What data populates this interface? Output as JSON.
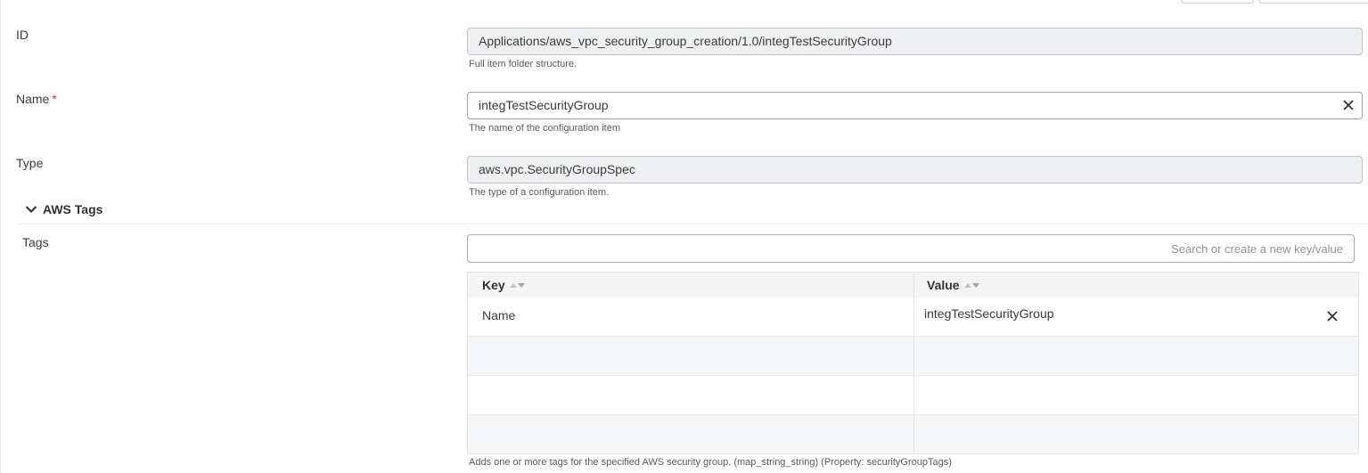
{
  "fields": {
    "id": {
      "label": "ID",
      "value": "Applications/aws_vpc_security_group_creation/1.0/integTestSecurityGroup",
      "help": "Full item folder structure."
    },
    "name": {
      "label": "Name",
      "required_mark": "*",
      "value": "integTestSecurityGroup",
      "help": "The name of the configuration item",
      "clear_icon": "close-icon"
    },
    "type": {
      "label": "Type",
      "value": "aws.vpc.SecurityGroupSpec",
      "help": "The type of a configuration item."
    }
  },
  "section": {
    "title": "AWS Tags",
    "icon": "chevron-down-icon"
  },
  "tags": {
    "label": "Tags",
    "search_placeholder": "Search or create a new key/value",
    "columns": {
      "key": "Key",
      "value": "Value"
    },
    "rows": [
      {
        "key": "Name",
        "value": "integTestSecurityGroup"
      }
    ],
    "help": "Adds one or more tags for the specified AWS security group. (map_string_string) (Property: securityGroupTags)"
  },
  "colors": {
    "required": "#d0332c",
    "readonly_bg": "#eef0f2",
    "header_bg": "#f3f4f6",
    "stripe_bg": "#f5f6f7"
  }
}
